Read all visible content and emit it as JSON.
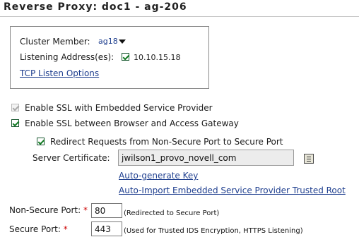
{
  "header": {
    "title": "Reverse Proxy: doc1 - ag-206"
  },
  "cluster_box": {
    "cluster_member_label": "Cluster Member:",
    "cluster_member_value": "ag18",
    "listening_label": "Listening Address(es):",
    "listening_checked": true,
    "listening_address": "10.10.15.18",
    "tcp_link": "TCP Listen Options"
  },
  "options": {
    "enable_ssl_esp": {
      "label": "Enable SSL with Embedded Service Provider",
      "checked": true,
      "disabled": true
    },
    "enable_ssl_browser": {
      "label": "Enable SSL between Browser and Access Gateway",
      "checked": true
    },
    "redirect": {
      "label": "Redirect Requests from Non-Secure Port to Secure Port",
      "checked": true
    }
  },
  "certificate": {
    "label": "Server Certificate:",
    "value": "jwilson1_provo_novell_com",
    "icon": "certificate-list-icon",
    "auto_generate_link": "Auto-generate Key",
    "auto_import_link": "Auto-Import Embedded Service Provider Trusted Root"
  },
  "ports": {
    "non_secure_label": "Non-Secure Port:",
    "non_secure_value": "80",
    "non_secure_note": "(Redirected to Secure Port)",
    "secure_label": "Secure Port:",
    "secure_value": "443",
    "secure_note": "(Used for Trusted IDS Encryption, HTTPS Listening)",
    "required_mark": "*"
  },
  "colors": {
    "link": "#1f3f8f",
    "required": "#cc0000",
    "check": "#157c26"
  }
}
